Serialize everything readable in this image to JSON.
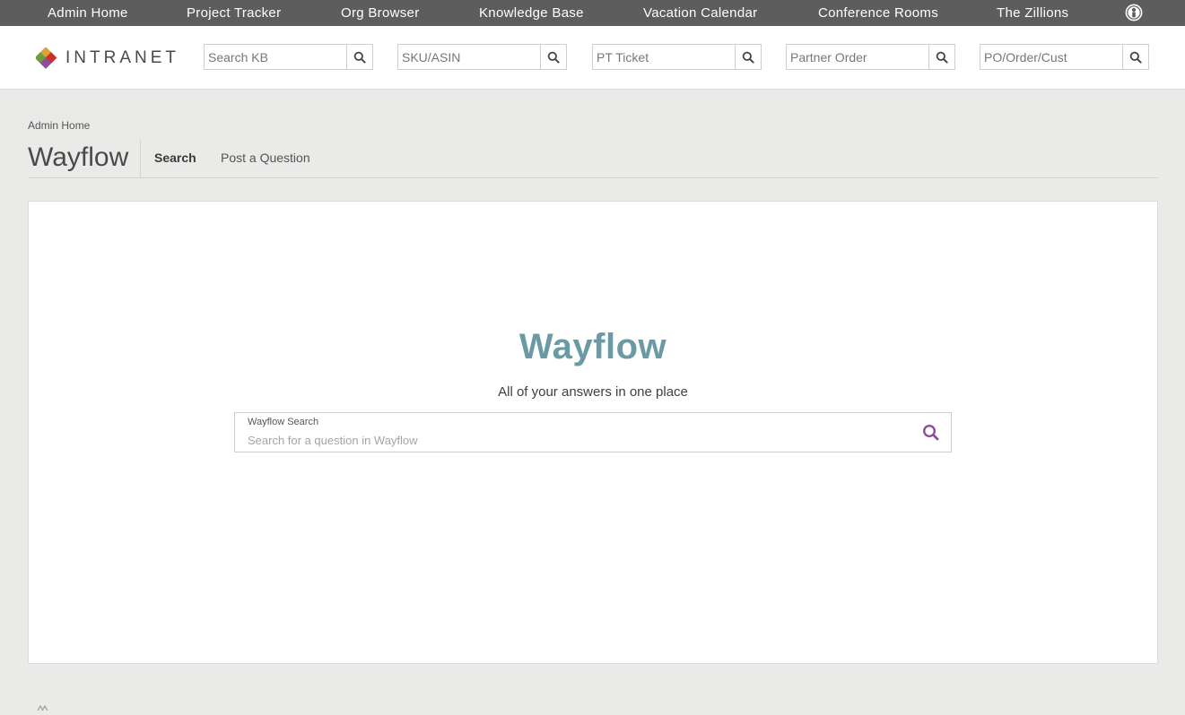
{
  "topnav": {
    "items": [
      {
        "label": "Admin Home"
      },
      {
        "label": "Project Tracker"
      },
      {
        "label": "Org Browser"
      },
      {
        "label": "Knowledge Base"
      },
      {
        "label": "Vacation Calendar"
      },
      {
        "label": "Conference Rooms"
      },
      {
        "label": "The Zillions"
      }
    ],
    "user_icon": "user-profile-icon"
  },
  "header": {
    "logo_text": "INTRANET",
    "logo_colors": [
      "#d9a23a",
      "#8e4f9a",
      "#6f9c3b",
      "#c9302c"
    ],
    "quick_searches": [
      {
        "placeholder": "Search KB",
        "icon": "search-icon"
      },
      {
        "placeholder": "SKU/ASIN",
        "icon": "search-icon"
      },
      {
        "placeholder": "PT Ticket",
        "icon": "search-icon"
      },
      {
        "placeholder": "Partner Order",
        "icon": "search-icon"
      },
      {
        "placeholder": "PO/Order/Cust",
        "icon": "search-icon"
      }
    ]
  },
  "page": {
    "breadcrumb": "Admin Home",
    "title": "Wayflow",
    "tabs": [
      {
        "label": "Search",
        "active": true
      },
      {
        "label": "Post a Question",
        "active": false
      }
    ]
  },
  "main": {
    "hero_title": "Wayflow",
    "tagline": "All of your answers in one place",
    "search": {
      "label": "Wayflow Search",
      "placeholder": "Search for a question in Wayflow",
      "value": "",
      "icon": "search-icon"
    }
  },
  "colors": {
    "topnav_bg": "#5d5d5d",
    "page_bg": "#eaeae8",
    "hero_title": "#6a9ba5",
    "search_accent": "#8e4f9a"
  }
}
